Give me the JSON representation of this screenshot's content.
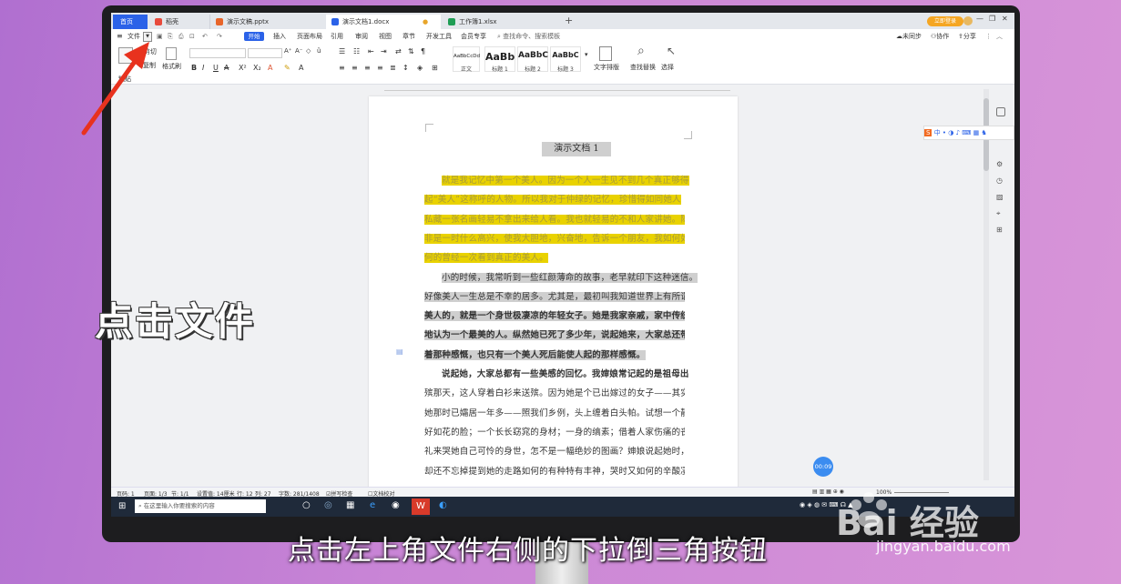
{
  "tabs": {
    "home": "首页",
    "daoke": "稻壳",
    "ppt": "演示文稿.pptx",
    "doc": "演示文档1.docx",
    "xls": "工作簿1.xlsx"
  },
  "login_button": "立即登录",
  "menu": {
    "file": "文件",
    "items": [
      "开始",
      "插入",
      "页面布局",
      "引用",
      "审阅",
      "视图",
      "章节",
      "开发工具",
      "会员专享"
    ],
    "search": "查找命令、搜索模板",
    "right": [
      "未同步",
      "协作",
      "分享"
    ]
  },
  "ribbon": {
    "paste": "粘贴",
    "cut": "剪切",
    "copy": "复制",
    "format_painter": "格式刷",
    "styles": [
      {
        "preview": "AaBbCcDd",
        "name": "正文"
      },
      {
        "preview": "AaBb",
        "name": "标题 1"
      },
      {
        "preview": "AaBbC",
        "name": "标题 2"
      },
      {
        "preview": "AaBbC",
        "name": "标题 3"
      }
    ],
    "text_layout": "文字排版",
    "find_replace": "查找替换",
    "select": "选择"
  },
  "document": {
    "title": "演示文档 1",
    "lines": [
      {
        "text": "就是我记忆中第一个美人。因为一个人一生见不到几个真正够得",
        "hl": "y",
        "bold": false,
        "indent": true
      },
      {
        "text": "起“美人”这称呼的人物。所以我对于仲绿的记忆，珍惜得如同她人",
        "hl": "y",
        "bold": false,
        "indent": false
      },
      {
        "text": "私藏一张名画轻易不拿出来给人看。我也就轻易的不和人家讲她。除",
        "hl": "y",
        "bold": false,
        "indent": false
      },
      {
        "text": "非是一时什么高兴，使我大胆地，兴奋地，告诉一个朋友，我如何如",
        "hl": "y",
        "bold": false,
        "indent": false
      },
      {
        "text": "何的曾经一次看到真正的美人。",
        "hl": "y",
        "bold": false,
        "indent": false
      },
      {
        "text": "小的时候，我常听到一些红颜薄命的故事，老早就印下这种迷信。",
        "hl": "g",
        "bold": false,
        "indent": true
      },
      {
        "text": "好像美人一生总是不幸的居多。尤其是，最初叫我知道世界上有所谓",
        "hl": "g",
        "bold": false,
        "indent": false
      },
      {
        "text": "美人的，就是一个身世极凄凉的年轻女子。她是我家亲戚，家中传统",
        "hl": "g",
        "bold": true,
        "indent": false
      },
      {
        "text": "地认为一个最美的人。纵然她已死了多少年，说起她来，大家总还带",
        "hl": "g",
        "bold": true,
        "indent": false
      },
      {
        "text": "着那种感慨，也只有一个美人死后能使人起的那样感慨。",
        "hl": "g",
        "bold": true,
        "indent": false
      },
      {
        "text": "说起她，大家总都有一些美感的回忆。我婶娘常记起的是祖母出",
        "hl": "",
        "bold": true,
        "indent": true
      },
      {
        "text": "殡那天，这人穿着白衫来送殡。因为她是个已出嫁过的女子——其实",
        "hl": "",
        "bold": false,
        "indent": false
      },
      {
        "text": "她那时已孀居一年多——照我们乡例，头上缠着白头帕。试想一个静",
        "hl": "",
        "bold": false,
        "indent": false
      },
      {
        "text": "好如花的脸；一个长长窈窕的身材；一身的缟素；借着人家伤痛的丧",
        "hl": "",
        "bold": false,
        "indent": false
      },
      {
        "text": "礼来哭她自己可怜的身世，怎不是一幅绝妙的图画？婶娘说起她时，",
        "hl": "",
        "bold": false,
        "indent": false
      },
      {
        "text": "却还不忘掉提到她的走路如何的有种特有丰神，哭时又如何的辛酸凄",
        "hl": "",
        "bold": false,
        "indent": false
      }
    ]
  },
  "timer": "00:09",
  "status": {
    "page": "页码: 1",
    "pages": "页面: 1/3",
    "section": "节: 1/1",
    "setting": "设置值: 14厘米",
    "row": "行: 12",
    "col": "列: 27",
    "words": "字数: 281/1408",
    "spell": "拼写检查",
    "proof": "文档校对",
    "zoom": "100%"
  },
  "taskbar": {
    "search": "在这里输入你要搜索的内容"
  },
  "caption1": "点击文件",
  "caption2": "点击左上角文件右侧的下拉倒三角按钮",
  "watermark": {
    "brand": "Bai  经验",
    "url": "jingyan.baidu.com"
  },
  "colors": {
    "accent": "#2b62e8",
    "highlight_yellow": "#e9d200",
    "highlight_gray": "#cfcfcf",
    "arrow": "#e8321e"
  }
}
